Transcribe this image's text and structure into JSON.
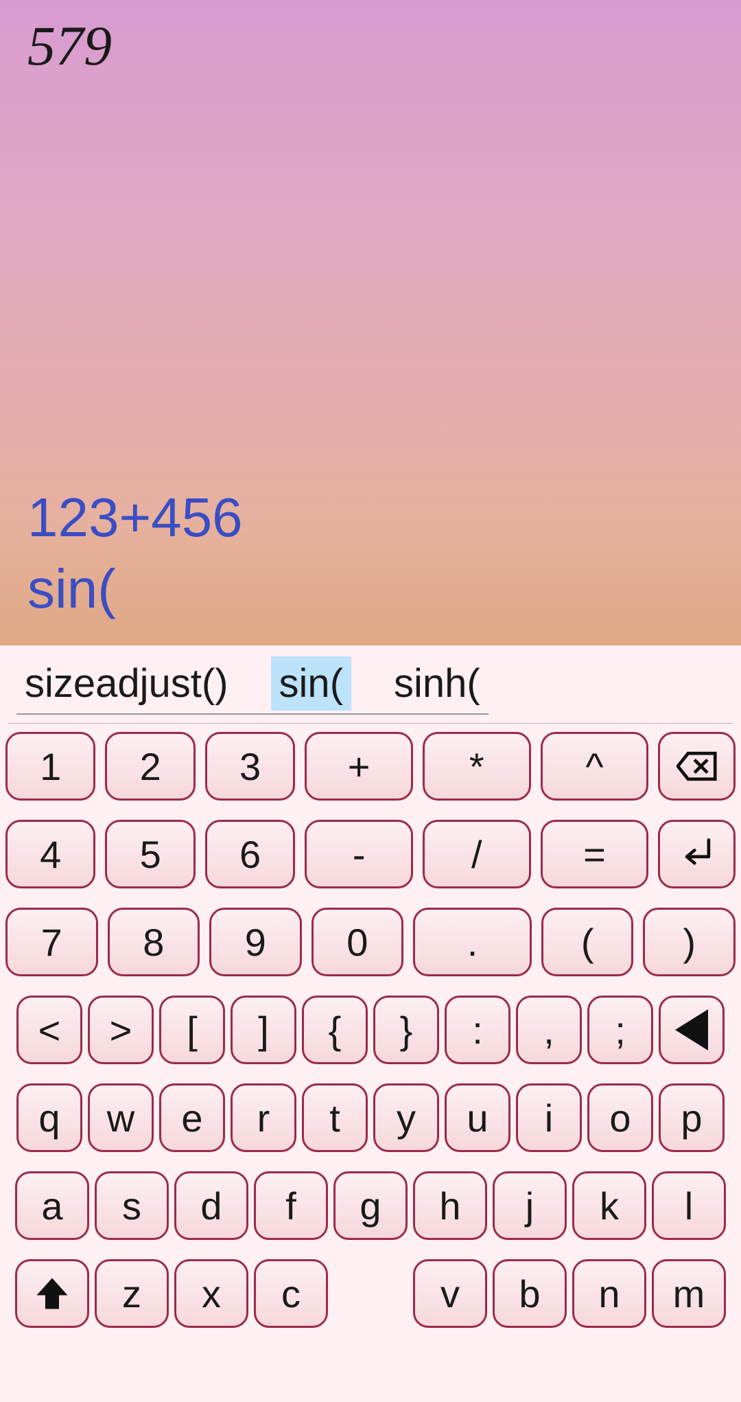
{
  "display": {
    "result": "579",
    "expression_line1": "123+456",
    "expression_line2": "sin("
  },
  "suggestions": {
    "items": [
      "sizeadjust()",
      "sin(",
      "sinh("
    ],
    "selected_index": 1
  },
  "keyboard": {
    "row1": [
      "1",
      "2",
      "3",
      "+",
      "*",
      "^"
    ],
    "row2": [
      "4",
      "5",
      "6",
      "-",
      "/",
      "="
    ],
    "row3": [
      "7",
      "8",
      "9",
      "0",
      ".",
      "(",
      ")"
    ],
    "row4": [
      "<",
      ">",
      "[",
      "]",
      "{",
      "}",
      ":",
      ",",
      ";"
    ],
    "row5": [
      "q",
      "w",
      "e",
      "r",
      "t",
      "y",
      "u",
      "i",
      "o",
      "p"
    ],
    "row6": [
      "a",
      "s",
      "d",
      "f",
      "g",
      "h",
      "j",
      "k",
      "l"
    ],
    "row7": [
      "z",
      "x",
      "c",
      "v",
      "b",
      "n",
      "m"
    ]
  },
  "icons": {
    "backspace": "backspace",
    "enter": "enter",
    "left": "left-triangle",
    "shift": "shift-up"
  }
}
